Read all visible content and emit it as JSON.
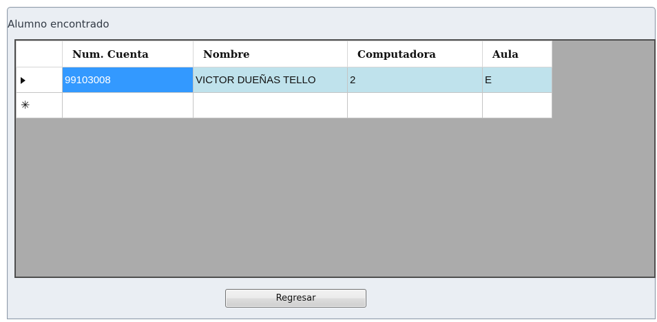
{
  "window": {
    "title": "Alumno encontrado"
  },
  "grid": {
    "columns": [
      "Num. Cuenta",
      "Nombre",
      "Computadora",
      "Aula"
    ],
    "rows": [
      {
        "num_cuenta": "99103008",
        "nombre": "VICTOR DUEÑAS TELLO",
        "computadora": "2",
        "aula": "E"
      }
    ],
    "new_row_marker": "✳"
  },
  "buttons": {
    "back_label": "Regresar"
  },
  "colors": {
    "grid_background": "#ababab",
    "selected_row": "#bfe2ec",
    "active_cell": "#3399ff"
  },
  "icons": {
    "current_row": "current-row-arrow-icon",
    "new_row": "new-row-asterisk-icon"
  }
}
